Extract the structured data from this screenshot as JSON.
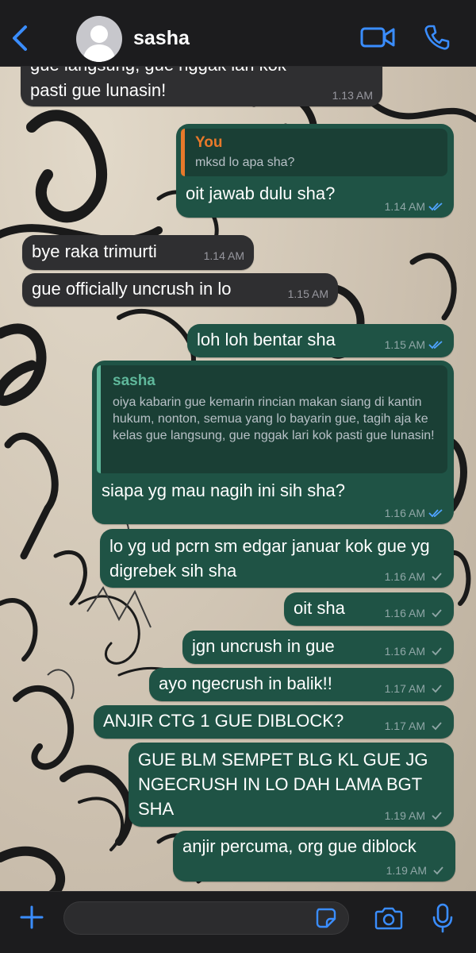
{
  "header": {
    "contact_name": "sasha"
  },
  "colors": {
    "accent": "#3a8dff",
    "outgoing": "#1f5345",
    "incoming": "#2f2f31",
    "quote_you": "#e8792a",
    "quote_sasha": "#5fb89b"
  },
  "messages": [
    {
      "dir": "in",
      "text": "gue langsung, gue nggak lari kok pasti gue lunasin!",
      "time": "1.13 AM"
    },
    {
      "dir": "out",
      "quote_author": "You",
      "quote_text": "mksd lo apa sha?",
      "text": "oit jawab dulu sha?",
      "time": "1.14 AM",
      "status": "read"
    },
    {
      "dir": "in",
      "text": "bye raka trimurti",
      "time": "1.14 AM"
    },
    {
      "dir": "in",
      "text": "gue officially uncrush in lo",
      "time": "1.15 AM"
    },
    {
      "dir": "out",
      "text": "loh loh bentar sha",
      "time": "1.15 AM",
      "status": "read"
    },
    {
      "dir": "out",
      "quote_author": "sasha",
      "quote_text": "oiya kabarin gue kemarin rincian makan siang di kantin hukum, nonton, semua yang lo bayarin gue, tagih aja ke kelas gue langsung, gue nggak lari kok pasti gue lunasin!",
      "text": "siapa yg mau nagih ini sih sha?",
      "time": "1.16 AM",
      "status": "read"
    },
    {
      "dir": "out",
      "text": "lo yg ud pcrn sm edgar januar kok gue yg digrebek sih sha",
      "time": "1.16 AM",
      "status": "sent"
    },
    {
      "dir": "out",
      "text": "oit sha",
      "time": "1.16 AM",
      "status": "sent"
    },
    {
      "dir": "out",
      "text": "jgn uncrush in gue",
      "time": "1.16 AM",
      "status": "sent"
    },
    {
      "dir": "out",
      "text": "ayo ngecrush in balik!!",
      "time": "1.17 AM",
      "status": "sent"
    },
    {
      "dir": "out",
      "text": "ANJIR CTG 1 GUE DIBLOCK?",
      "time": "1.17 AM",
      "status": "sent"
    },
    {
      "dir": "out",
      "text": "GUE BLM SEMPET BLG KL GUE JG NGECRUSH IN LO DAH LAMA BGT SHA",
      "time": "1.19 AM",
      "status": "sent"
    },
    {
      "dir": "out",
      "text": "anjir percuma, org gue diblock",
      "time": "1.19 AM",
      "status": "sent"
    }
  ],
  "composer": {
    "input_value": "",
    "input_placeholder": ""
  }
}
